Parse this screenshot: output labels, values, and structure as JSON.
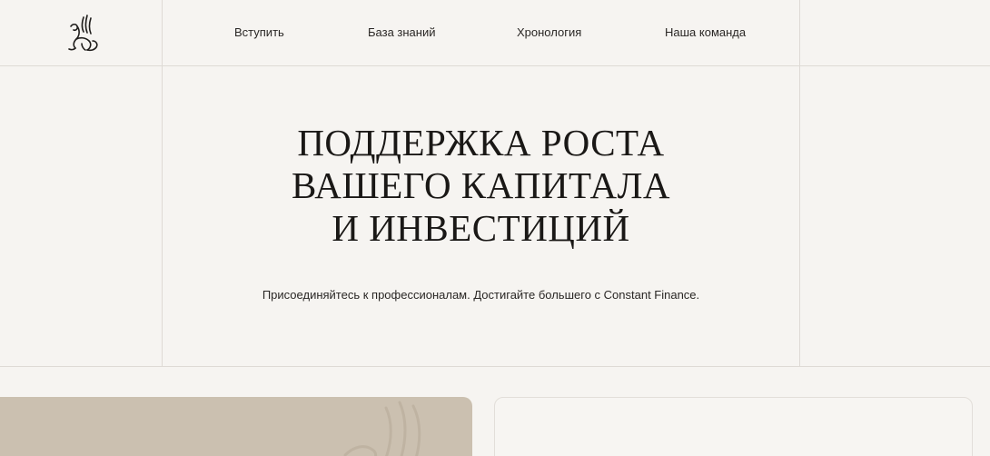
{
  "nav": {
    "items": [
      {
        "label": "Вступить"
      },
      {
        "label": "База знаний"
      },
      {
        "label": "Хронология"
      },
      {
        "label": "Наша команда"
      }
    ]
  },
  "hero": {
    "title_lines": [
      "ПОДДЕРЖКА РОСТА",
      "ВАШЕГО КАПИТАЛА",
      "И ИНВЕСТИЦИЙ"
    ],
    "subtitle": "Присоединяйтесь к профессионалам. Достигайте большего с Constant Finance."
  },
  "icons": {
    "logo": "griffin-logo-icon",
    "card_watermark": "griffin-watermark-icon"
  },
  "colors": {
    "background": "#f6f4f1",
    "text": "#1a1816",
    "grid_lines": "#dedad5",
    "card_left": "#cbc0b0",
    "card_right": "#f7f5f2"
  }
}
